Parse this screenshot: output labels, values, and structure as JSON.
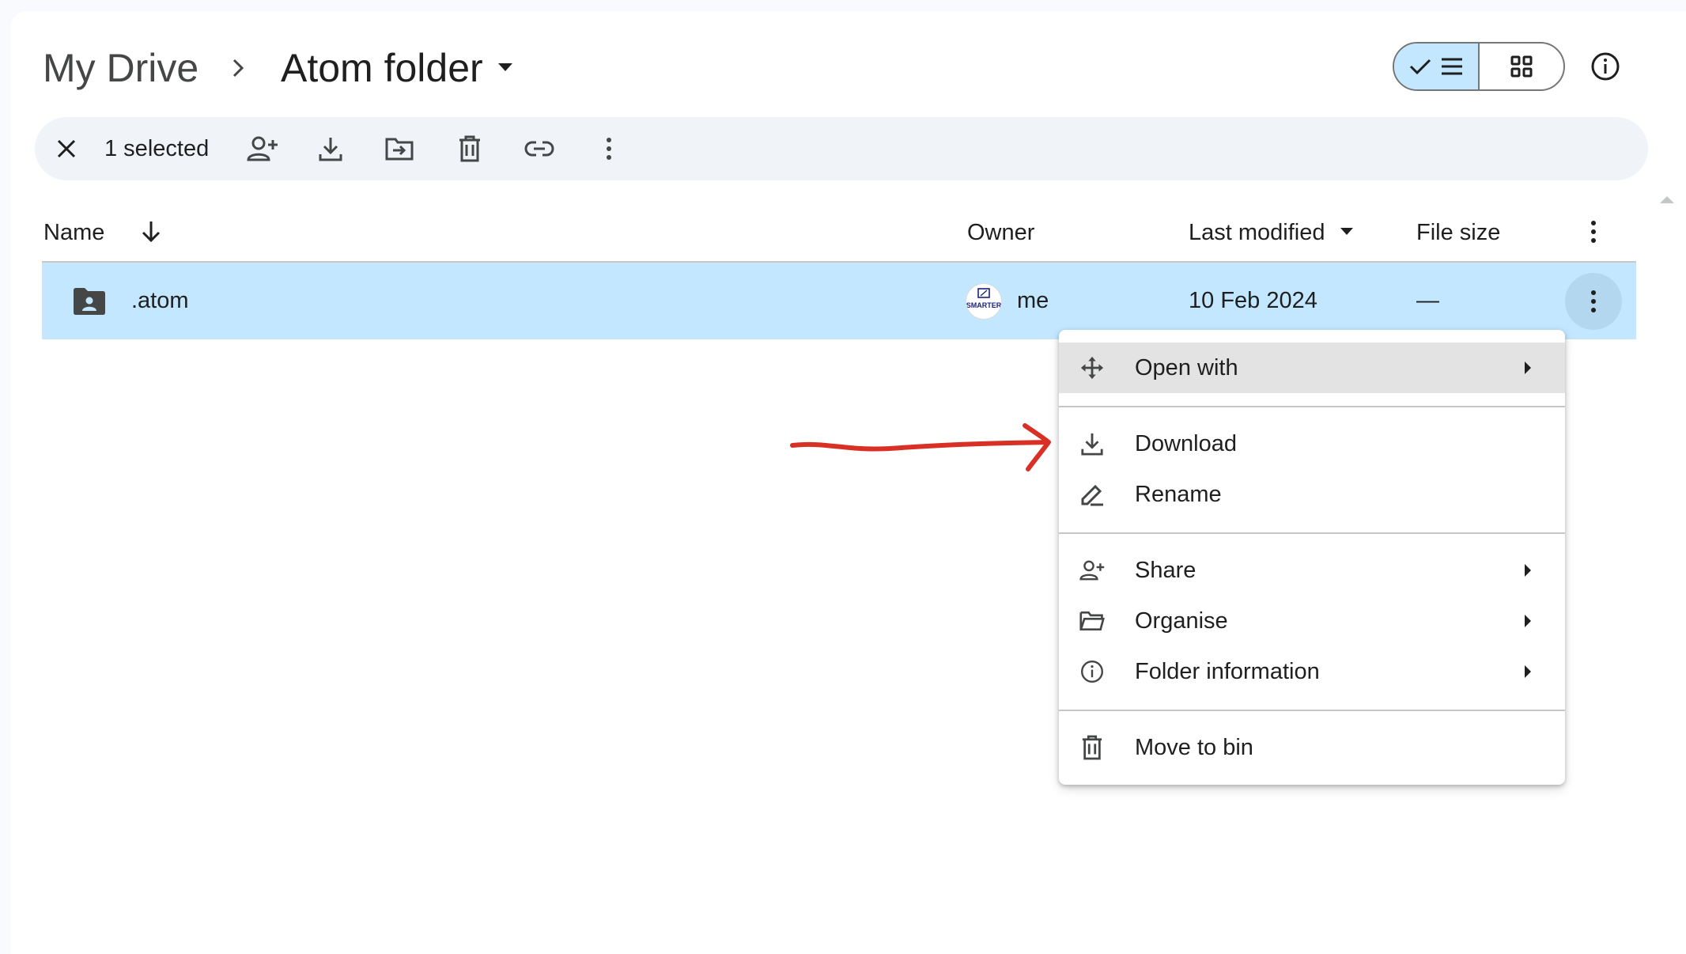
{
  "breadcrumb": {
    "root": "My Drive",
    "current": "Atom folder"
  },
  "view_toggle": {
    "list_selected": true,
    "icons": [
      "check-icon",
      "list-icon",
      "grid-icon"
    ]
  },
  "action_bar": {
    "selected_count": "1 selected",
    "actions": [
      "clear-selection",
      "share",
      "download",
      "move",
      "move-to-bin",
      "copy-link",
      "more-actions"
    ]
  },
  "table": {
    "columns": {
      "name": "Name",
      "owner": "Owner",
      "last_modified": "Last modified",
      "file_size": "File size"
    },
    "rows": [
      {
        "name": ".atom",
        "owner": "me",
        "avatar_text": "SMARTER",
        "last_modified": "10 Feb 2024",
        "file_size": "—",
        "type": "shared-folder"
      }
    ]
  },
  "context_menu": {
    "items": [
      {
        "label": "Open with",
        "icon": "open-with-icon",
        "has_submenu": true,
        "highlighted": true
      },
      {
        "label": "Download",
        "icon": "download-icon",
        "has_submenu": false
      },
      {
        "label": "Rename",
        "icon": "rename-icon",
        "has_submenu": false
      },
      {
        "label": "Share",
        "icon": "share-icon",
        "has_submenu": true
      },
      {
        "label": "Organise",
        "icon": "folder-open-icon",
        "has_submenu": true
      },
      {
        "label": "Folder information",
        "icon": "info-icon",
        "has_submenu": true
      },
      {
        "label": "Move to bin",
        "icon": "trash-icon",
        "has_submenu": false
      }
    ]
  },
  "colors": {
    "selected_row": "#c2e7ff",
    "annotation_arrow": "#d93025",
    "action_bar_bg": "#f0f4f9"
  }
}
